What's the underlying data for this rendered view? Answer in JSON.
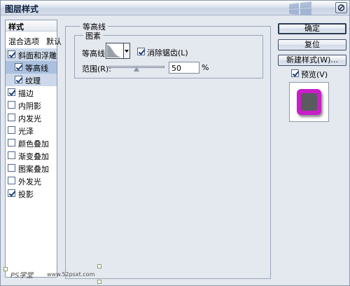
{
  "window": {
    "title": "图层样式"
  },
  "styles_list": {
    "header": "样式",
    "blending": {
      "label": "混合选项",
      "default": "默认"
    },
    "items": [
      {
        "label": "斜面和浮雕",
        "checked": true
      },
      {
        "label": "等高线",
        "checked": true
      },
      {
        "label": "纹理",
        "checked": true
      },
      {
        "label": "描边",
        "checked": true
      },
      {
        "label": "内阴影",
        "checked": false
      },
      {
        "label": "内发光",
        "checked": false
      },
      {
        "label": "光泽",
        "checked": false
      },
      {
        "label": "颜色叠加",
        "checked": false
      },
      {
        "label": "渐变叠加",
        "checked": false
      },
      {
        "label": "图案叠加",
        "checked": false
      },
      {
        "label": "外发光",
        "checked": false
      },
      {
        "label": "投影",
        "checked": true
      }
    ]
  },
  "panel": {
    "section_title": "等高线",
    "group_title": "图素",
    "contour_label": "等高线:",
    "antialias_label": "消除锯齿(L)",
    "range_label": "范围(R):",
    "range_value": "50",
    "range_unit": "%",
    "range_fraction": 0.5
  },
  "buttons": {
    "ok": "确定",
    "reset": "复位",
    "new_style": "新建样式(W)...",
    "preview": "预览(V)"
  },
  "watermark": {
    "text": "PS学堂",
    "url": "www.52psxt.com"
  },
  "colors": {
    "preview_outer": "#c81fc9",
    "preview_inner": "#5a5b5e",
    "accent": "#aac0de"
  }
}
